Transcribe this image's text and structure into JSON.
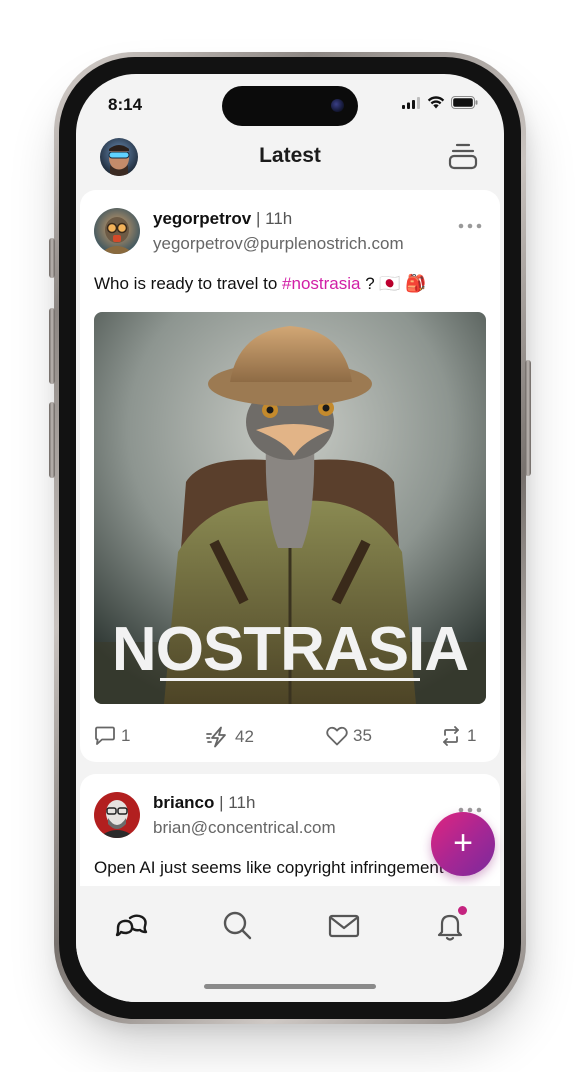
{
  "status_bar": {
    "time": "8:14"
  },
  "header": {
    "title": "Latest"
  },
  "posts": [
    {
      "author": "yegorpetrov",
      "separator": "|",
      "time": "11h",
      "handle": "yegorpetrov@purplenostrich.com",
      "text_before": "Who is ready to travel to ",
      "hashtag": "#nostrasia",
      "text_after": " ? 🇯🇵 🎒",
      "image_caption": "NOSTRASIA",
      "actions": {
        "replies": "1",
        "zaps": "42",
        "likes": "35",
        "reposts": "1"
      }
    },
    {
      "author": "brianco",
      "separator": "|",
      "time": "11h",
      "handle": "brian@concentrical.com",
      "text": "Open AI just seems like copyright infringement"
    }
  ],
  "fab": {
    "label": "+"
  },
  "nav": {
    "items": [
      "home-chat",
      "search",
      "messages",
      "notifications"
    ],
    "notification_dot_color": "#c4237f"
  },
  "colors": {
    "accent": "#d11ea6",
    "fab_start": "#e0247f",
    "fab_end": "#7a2a9c"
  }
}
